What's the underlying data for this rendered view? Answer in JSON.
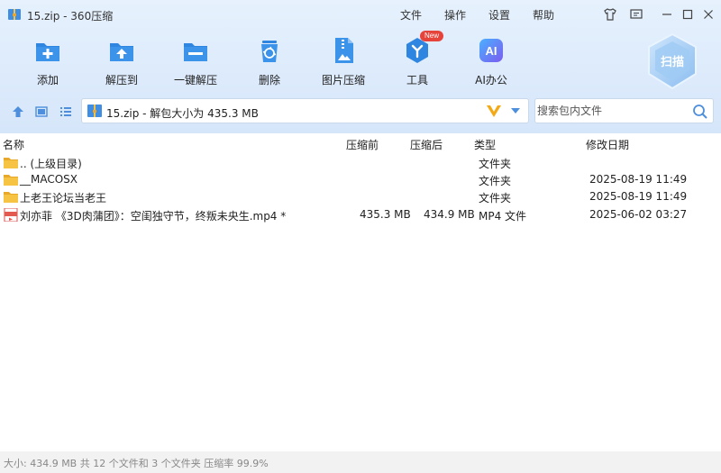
{
  "window": {
    "title": "15.zip - 360压缩"
  },
  "menu": [
    "文件",
    "操作",
    "设置",
    "帮助"
  ],
  "toolbar": [
    {
      "label": "添加",
      "icon": "add-icon"
    },
    {
      "label": "解压到",
      "icon": "extract-to-icon"
    },
    {
      "label": "一键解压",
      "icon": "one-click-extract-icon"
    },
    {
      "label": "删除",
      "icon": "delete-icon"
    },
    {
      "label": "图片压缩",
      "icon": "image-compress-icon"
    },
    {
      "label": "工具",
      "icon": "tools-icon",
      "badge": "New"
    },
    {
      "label": "AI办公",
      "icon": "ai-office-icon",
      "glyph": "AI"
    }
  ],
  "scan": {
    "label": "扫描"
  },
  "address": {
    "path": "15.zip - 解包大小为 435.3 MB"
  },
  "search": {
    "placeholder": "搜索包内文件"
  },
  "columns": {
    "name": "名称",
    "before": "压缩前",
    "after": "压缩后",
    "type": "类型",
    "date": "修改日期"
  },
  "files": [
    {
      "name": ".. (上级目录)",
      "before": "",
      "after": "",
      "type": "文件夹",
      "date": "",
      "kind": "folder"
    },
    {
      "name": "__MACOSX",
      "before": "",
      "after": "",
      "type": "文件夹",
      "date": "2025-08-19 11:49",
      "kind": "folder"
    },
    {
      "name": "上老王论坛当老王",
      "before": "",
      "after": "",
      "type": "文件夹",
      "date": "2025-08-19 11:49",
      "kind": "folder"
    },
    {
      "name": "刘亦菲 《3D肉蒲团》：空闺独守节，终叛未央生.mp4 *",
      "before": "435.3 MB",
      "after": "434.9 MB",
      "type": "MP4 文件",
      "date": "2025-06-02 03:27",
      "kind": "video"
    }
  ],
  "status": {
    "text": "大小: 434.9 MB 共 12 个文件和 3 个文件夹 压缩率 99.9%"
  },
  "colors": {
    "accent": "#2f86e0",
    "folder": "#f6c343"
  }
}
